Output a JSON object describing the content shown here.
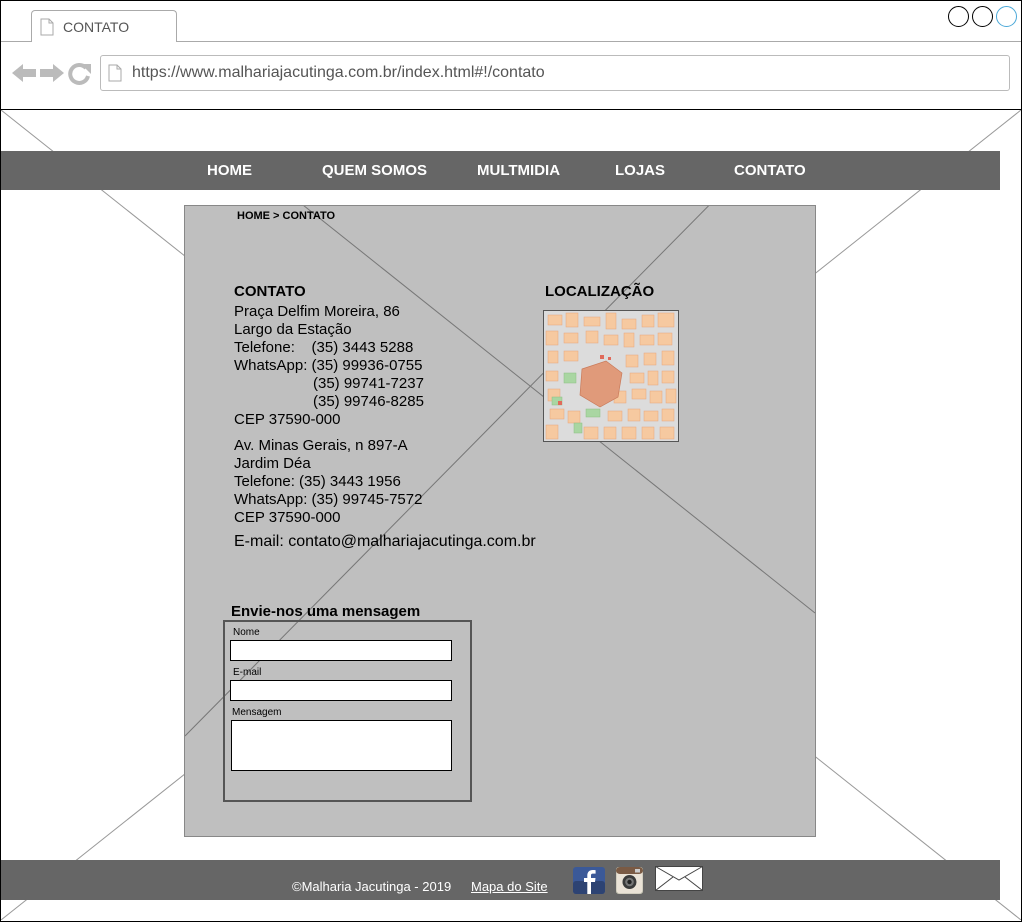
{
  "browser": {
    "tab_title": "CONTATO",
    "url": "https://www.malhariajacutinga.com.br/index.html#!/contato"
  },
  "nav": {
    "items": [
      {
        "label": "HOME"
      },
      {
        "label": "QUEM SOMOS"
      },
      {
        "label": "MULTMIDIA"
      },
      {
        "label": "LOJAS"
      },
      {
        "label": "CONTATO"
      }
    ]
  },
  "breadcrumb": "HOME > CONTATO",
  "contact": {
    "title": "CONTATO",
    "store1": {
      "street": "Praça Delfim Moreira, 86",
      "district": "Largo da Estação",
      "phone": "Telefone:    (35) 3443 5288",
      "whatsapp1": "WhatsApp: (35) 99936-0755",
      "whatsapp2": "(35) 99741-7237",
      "whatsapp3": "(35) 99746-8285",
      "cep": "CEP 37590-000"
    },
    "store2": {
      "street": "Av. Minas Gerais, n 897-A",
      "district": "Jardim Déa",
      "phone": "Telefone: (35) 3443 1956",
      "whatsapp": "WhatsApp: (35) 99745-7572",
      "cep": "CEP 37590-000"
    },
    "email": "E-mail: contato@malhariajacutinga.com.br"
  },
  "location": {
    "title": "LOCALIZAÇÃO"
  },
  "form": {
    "title": "Envie-nos uma mensagem",
    "name_label": "Nome",
    "email_label": "E-mail",
    "message_label": "Mensagem"
  },
  "footer": {
    "copyright": "©Malharia Jacutinga - 2019",
    "sitemap": "Mapa do Site"
  },
  "icons": {
    "facebook": "facebook-icon",
    "instagram": "instagram-icon",
    "email": "envelope-icon"
  },
  "colors": {
    "nav_bg": "#666666",
    "content_bg": "#bfbfbf",
    "window_accent": "#4aa8d8"
  }
}
